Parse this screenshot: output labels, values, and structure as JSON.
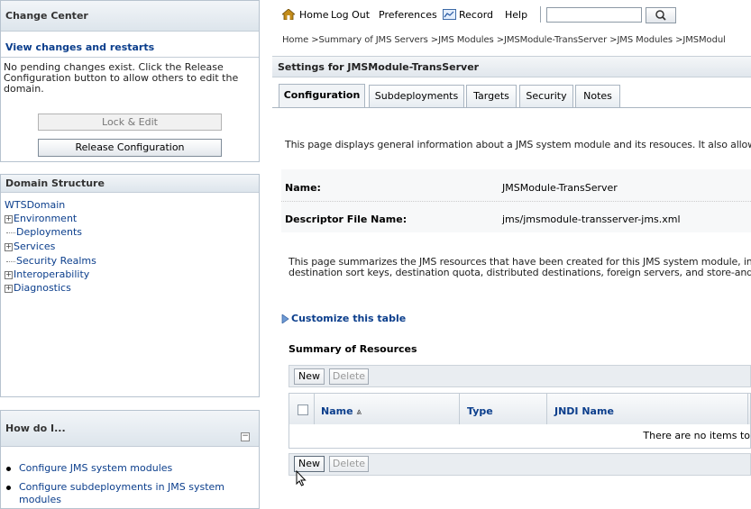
{
  "change_center": {
    "title": "Change Center",
    "view_changes": "View changes and restarts",
    "message_l1": "No pending changes exist. Click the Release",
    "message_l2": "Configuration button to allow others to edit the",
    "message_l3": "domain.",
    "lock_edit": "Lock & Edit",
    "release_config": "Release Configuration"
  },
  "domain_structure": {
    "title": "Domain Structure",
    "root": "WTSDomain",
    "items": [
      {
        "label": "Environment",
        "expandable": true
      },
      {
        "label": "Deployments",
        "expandable": false
      },
      {
        "label": "Services",
        "expandable": true
      },
      {
        "label": "Security Realms",
        "expandable": false
      },
      {
        "label": "Interoperability",
        "expandable": true
      },
      {
        "label": "Diagnostics",
        "expandable": true
      }
    ]
  },
  "how_do_i": {
    "title": "How do I...",
    "items": [
      "Configure JMS system modules",
      "Configure subdeployments in JMS system",
      "modules"
    ]
  },
  "toolbar": {
    "home": "Home",
    "logout": "Log Out",
    "preferences": "Preferences",
    "record": "Record",
    "help": "Help",
    "search_value": ""
  },
  "breadcrumb": "Home >Summary of JMS Servers >JMS Modules >JMSModule-TransServer >JMS Modules >JMSModul",
  "settings_title": "Settings for JMSModule-TransServer",
  "tabs": [
    {
      "label": "Configuration",
      "active": true
    },
    {
      "label": "Subdeployments",
      "active": false
    },
    {
      "label": "Targets",
      "active": false
    },
    {
      "label": "Security",
      "active": false
    },
    {
      "label": "Notes",
      "active": false
    }
  ],
  "intro_text": "This page displays general information about a JMS system module and its resouces. It also allow",
  "fields": {
    "name_label": "Name:",
    "name_value": "JMSModule-TransServer",
    "descriptor_label": "Descriptor File Name:",
    "descriptor_value": "jms/jmsmodule-transserver-jms.xml"
  },
  "summary_text_l1": "This page summarizes the JMS resources that have been created for this JMS system module, in",
  "summary_text_l2": "destination sort keys, destination quota, distributed destinations, foreign servers, and store-and",
  "customize": "Customize this table",
  "table": {
    "title": "Summary of Resources",
    "new_label": "New",
    "delete_label": "Delete",
    "columns": [
      "Name",
      "Type",
      "JNDI Name"
    ],
    "empty_message": "There are no items to"
  }
}
